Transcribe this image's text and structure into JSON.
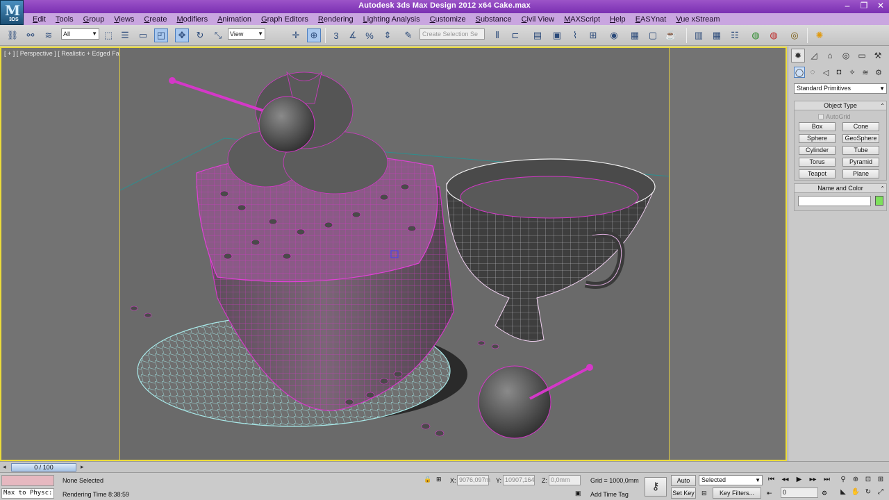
{
  "window": {
    "title": "Autodesk 3ds Max Design 2012 x64      Cake.max",
    "logo_text": "3DS",
    "controls": [
      "–",
      "❐",
      "✕"
    ]
  },
  "menu": [
    "Edit",
    "Tools",
    "Group",
    "Views",
    "Create",
    "Modifiers",
    "Animation",
    "Graph Editors",
    "Rendering",
    "Lighting Analysis",
    "Customize",
    "Substance",
    "Civil View",
    "MAXScript",
    "Help",
    "EASYnat",
    "Vue xStream"
  ],
  "toolbar": {
    "selection_filter": "All",
    "reference_coord": "View",
    "named_selection_placeholder": "Create Selection Se",
    "snap_label": "3"
  },
  "viewport": {
    "label": "[ + ] [ Perspective ] [ Realistic + Edged Faces ]"
  },
  "command_panel": {
    "category": "Standard Primitives",
    "object_type_title": "Object Type",
    "autogrid_label": "AutoGrid",
    "primitives": [
      "Box",
      "Cone",
      "Sphere",
      "GeoSphere",
      "Cylinder",
      "Tube",
      "Torus",
      "Pyramid",
      "Teapot",
      "Plane"
    ],
    "name_and_color_title": "Name and Color",
    "object_color": "#7ee05c"
  },
  "timeline": {
    "frame_display": "0 / 100"
  },
  "status": {
    "maxscript_listener": "Max to Physc:",
    "selection": "None Selected",
    "rendering_time_label": "Rendering Time  8:38:59",
    "x_label": "X:",
    "x_value": "9076,097m",
    "y_label": "Y:",
    "y_value": "10907,164",
    "z_label": "Z:",
    "z_value": "0,0mm",
    "grid": "Grid = 1000,0mm",
    "add_time_tag": "Add Time Tag",
    "auto_key": "Auto Key",
    "set_key": "Set Key",
    "key_mode": "Selected",
    "key_filters": "Key Filters...",
    "current_frame": "0"
  }
}
